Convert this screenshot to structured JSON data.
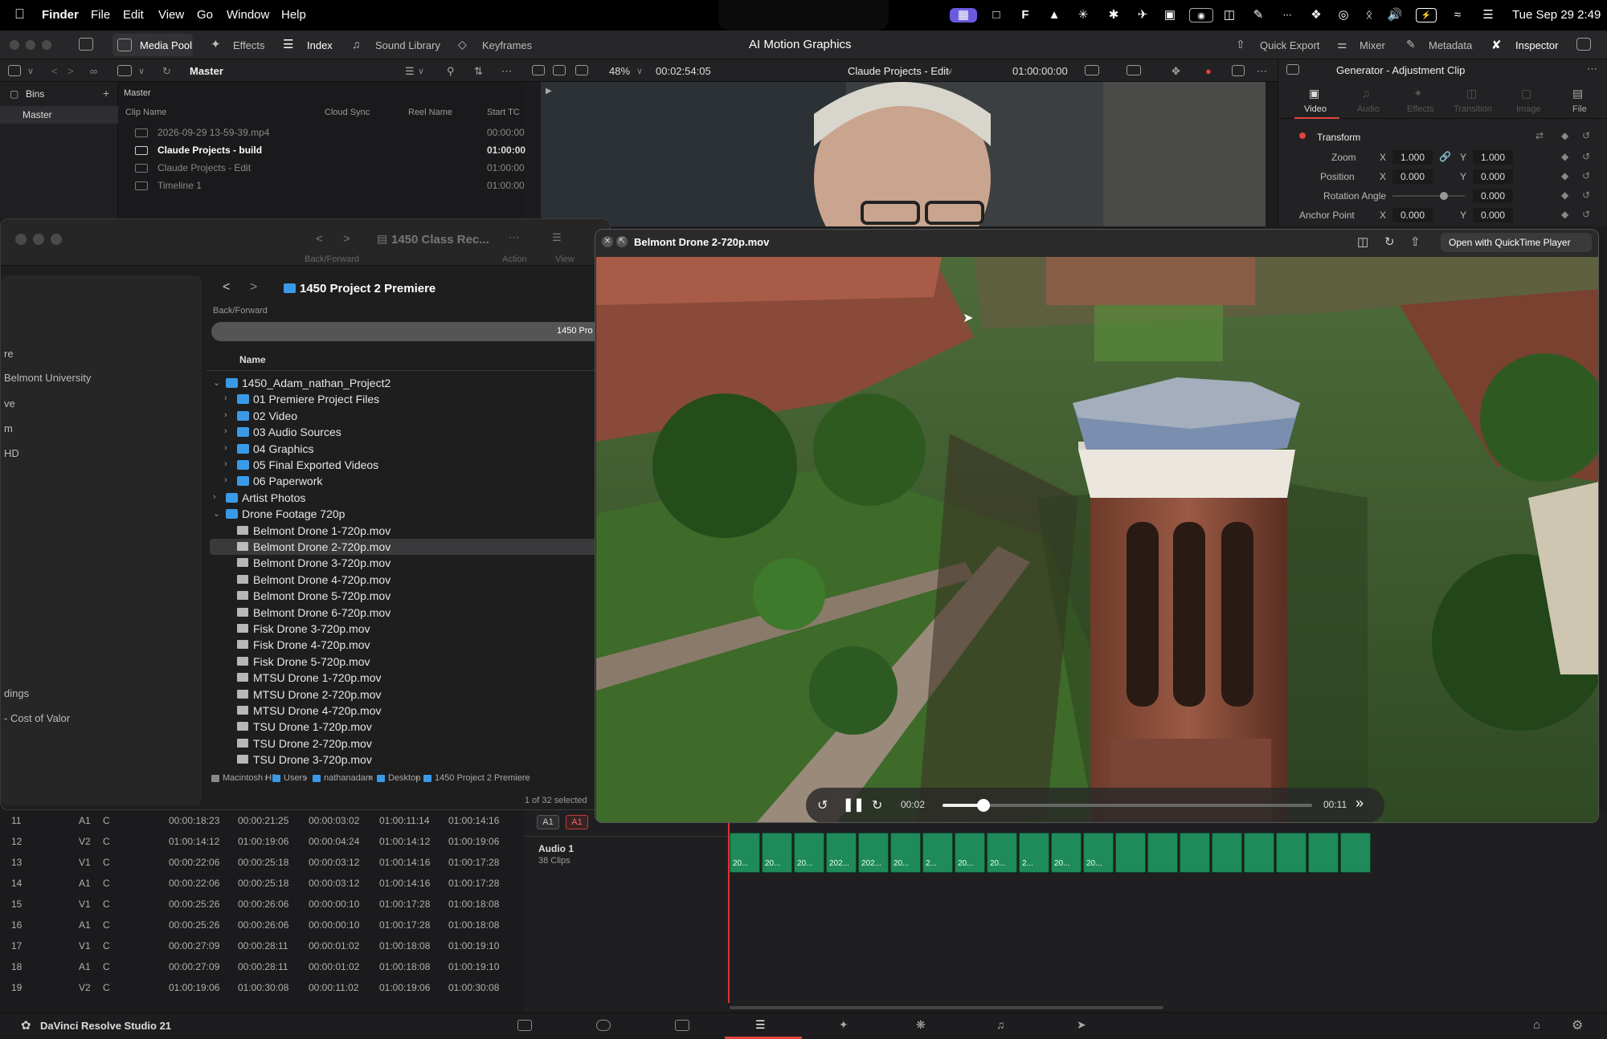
{
  "menubar": {
    "app": "Finder",
    "menus": [
      "File",
      "Edit",
      "View",
      "Go",
      "Window",
      "Help"
    ],
    "clock": "Tue Sep 29  2:49"
  },
  "resolve": {
    "tabs": [
      "Media Pool",
      "Effects",
      "Index",
      "Sound Library",
      "Keyframes"
    ],
    "project_title": "AI Motion Graphics",
    "right_tabs": [
      "Quick Export",
      "Mixer",
      "Metadata",
      "Inspector"
    ],
    "bin_path": "Master",
    "zoom": "48%",
    "timecode": "00:02:54:05",
    "timeline_name": "Claude Projects - Edit",
    "timeline_tc": "01:00:00:00",
    "inspector_title": "Generator - Adjustment Clip",
    "inspector_tabs": [
      "Video",
      "Audio",
      "Effects",
      "Transition",
      "Image",
      "File"
    ],
    "bins_label": "Bins",
    "bins_master": "Master",
    "clips_header": "Master",
    "columns": [
      "Clip Name",
      "Cloud Sync",
      "Reel Name",
      "Start TC"
    ],
    "clips": [
      {
        "name": "2026-09-29 13-59-39.mp4",
        "tc": "00:00:00"
      },
      {
        "name": "Claude Projects - build",
        "tc": "01:00:00"
      },
      {
        "name": "Claude Projects - Edit",
        "tc": "01:00:00"
      },
      {
        "name": "Timeline 1",
        "tc": "01:00:00"
      }
    ],
    "transform": {
      "label": "Transform",
      "zoom_label": "Zoom",
      "zoom_x": "1.000",
      "zoom_y": "1.000",
      "position_label": "Position",
      "pos_x": "0.000",
      "pos_y": "0.000",
      "rotation_label": "Rotation Angle",
      "rotation": "0.000",
      "anchor_label": "Anchor Point",
      "anchor_x": "0.000",
      "anchor_y": "0.000",
      "x": "X",
      "y": "Y"
    },
    "app_name": "DaVinci Resolve Studio 21"
  },
  "finder": {
    "back_window_title": "1450 Class Rec...",
    "back_forward": "Back/Forward",
    "action": "Action",
    "view": "View",
    "folder_title": "1450 Project 2 Premiere",
    "path_chip": "1450 Pro",
    "name_col": "Name",
    "sidebar": [
      "re",
      "Belmont University",
      "ve",
      "m",
      "HD",
      "dings",
      "- Cost of Valor"
    ],
    "rows": [
      {
        "label": "1450_Adam_nathan_Project2",
        "indent": 0,
        "type": "folder",
        "chev": "v"
      },
      {
        "label": "01 Premiere Project Files",
        "indent": 1,
        "type": "folder",
        "chev": ">"
      },
      {
        "label": "02 Video",
        "indent": 1,
        "type": "folder",
        "chev": ">"
      },
      {
        "label": "03 Audio Sources",
        "indent": 1,
        "type": "folder",
        "chev": ">"
      },
      {
        "label": "04 Graphics",
        "indent": 1,
        "type": "folder",
        "chev": ">"
      },
      {
        "label": "05 Final Exported Videos",
        "indent": 1,
        "type": "folder",
        "chev": ">"
      },
      {
        "label": "06 Paperwork",
        "indent": 1,
        "type": "folder",
        "chev": ">"
      },
      {
        "label": "Artist Photos",
        "indent": 0,
        "type": "folder",
        "chev": ">"
      },
      {
        "label": "Drone Footage 720p",
        "indent": 0,
        "type": "folder",
        "chev": "v"
      },
      {
        "label": "Belmont Drone 1-720p.mov",
        "indent": 1,
        "type": "file"
      },
      {
        "label": "Belmont Drone 2-720p.mov",
        "indent": 1,
        "type": "file",
        "selected": true
      },
      {
        "label": "Belmont Drone 3-720p.mov",
        "indent": 1,
        "type": "file"
      },
      {
        "label": "Belmont Drone 4-720p.mov",
        "indent": 1,
        "type": "file"
      },
      {
        "label": "Belmont Drone 5-720p.mov",
        "indent": 1,
        "type": "file"
      },
      {
        "label": "Belmont Drone 6-720p.mov",
        "indent": 1,
        "type": "file"
      },
      {
        "label": "Fisk Drone 3-720p.mov",
        "indent": 1,
        "type": "file"
      },
      {
        "label": "Fisk Drone 4-720p.mov",
        "indent": 1,
        "type": "file"
      },
      {
        "label": "Fisk Drone 5-720p.mov",
        "indent": 1,
        "type": "file"
      },
      {
        "label": "MTSU Drone 1-720p.mov",
        "indent": 1,
        "type": "file"
      },
      {
        "label": "MTSU Drone 2-720p.mov",
        "indent": 1,
        "type": "file"
      },
      {
        "label": "MTSU Drone 4-720p.mov",
        "indent": 1,
        "type": "file"
      },
      {
        "label": "TSU Drone 1-720p.mov",
        "indent": 1,
        "type": "file"
      },
      {
        "label": "TSU Drone 2-720p.mov",
        "indent": 1,
        "type": "file"
      },
      {
        "label": "TSU Drone 3-720p.mov",
        "indent": 1,
        "type": "file"
      }
    ],
    "pathbar": [
      "Macintosh HD",
      "Users",
      "nathanadam",
      "Desktop",
      "1450 Project 2 Premiere"
    ],
    "status": "1 of 32 selected"
  },
  "quicklook": {
    "title": "Belmont Drone 2-720p.mov",
    "open_with": "Open with QuickTime Player",
    "elapsed": "00:02",
    "remaining": "00:11",
    "progress": 0.11
  },
  "timeline": {
    "rows": [
      [
        "11",
        "A1",
        "C",
        "00:00:18:23",
        "00:00:21:25",
        "00:00:03:02",
        "01:00:11:14",
        "01:00:14:16"
      ],
      [
        "12",
        "V2",
        "C",
        "01:00:14:12",
        "01:00:19:06",
        "00:00:04:24",
        "01:00:14:12",
        "01:00:19:06"
      ],
      [
        "13",
        "V1",
        "C",
        "00:00:22:06",
        "00:00:25:18",
        "00:00:03:12",
        "01:00:14:16",
        "01:00:17:28"
      ],
      [
        "14",
        "A1",
        "C",
        "00:00:22:06",
        "00:00:25:18",
        "00:00:03:12",
        "01:00:14:16",
        "01:00:17:28"
      ],
      [
        "15",
        "V1",
        "C",
        "00:00:25:26",
        "00:00:26:06",
        "00:00:00:10",
        "01:00:17:28",
        "01:00:18:08"
      ],
      [
        "16",
        "A1",
        "C",
        "00:00:25:26",
        "00:00:26:06",
        "00:00:00:10",
        "01:00:17:28",
        "01:00:18:08"
      ],
      [
        "17",
        "V1",
        "C",
        "00:00:27:09",
        "00:00:28:11",
        "00:00:01:02",
        "01:00:18:08",
        "01:00:19:10"
      ],
      [
        "18",
        "A1",
        "C",
        "00:00:27:09",
        "00:00:28:11",
        "00:00:01:02",
        "01:00:18:08",
        "01:00:19:10"
      ],
      [
        "19",
        "V2",
        "C",
        "01:00:19:06",
        "01:00:30:08",
        "00:00:11:02",
        "01:00:19:06",
        "01:00:30:08"
      ]
    ],
    "track_a1": "A1",
    "audio_track_name": "Audio 1",
    "audio_clip_count": "38 Clips",
    "clip_labels": [
      "20...",
      "20...",
      "20...",
      "202...",
      "202...",
      "20...",
      "2...",
      "20...",
      "20...",
      "2...",
      "20...",
      "20..."
    ]
  },
  "colors": {
    "accent_red": "#e0443e",
    "folder_blue": "#3a9ae8",
    "clip_green": "#1f8a5a",
    "playhead": "#e03030"
  }
}
